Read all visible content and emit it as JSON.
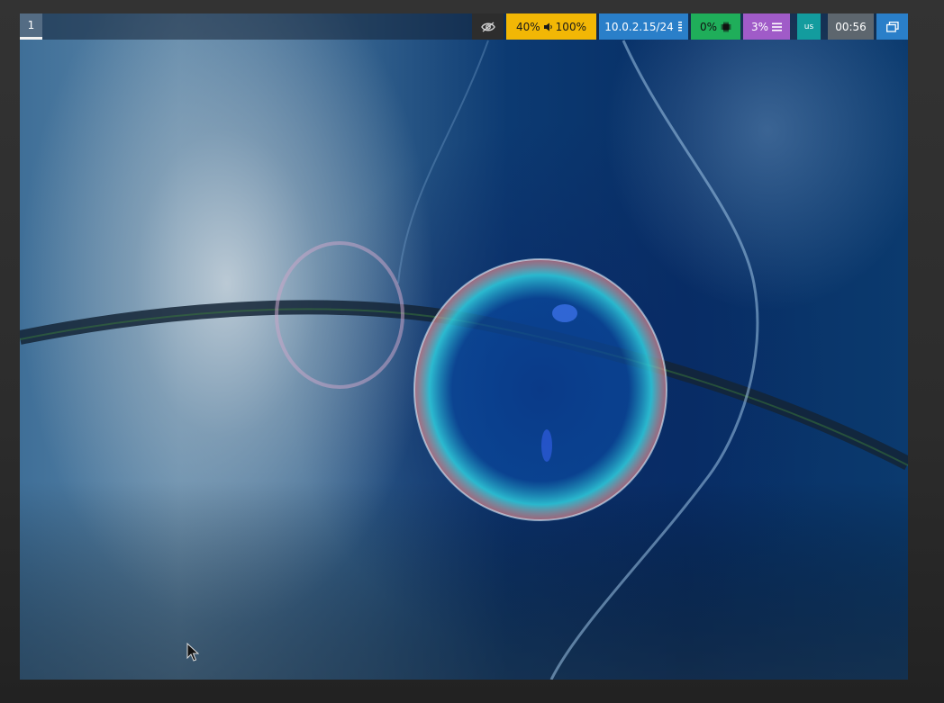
{
  "panel": {
    "workspace": "1",
    "audio": {
      "brightness": "40%",
      "volume": "100%"
    },
    "network": {
      "ip": "10.0.2.15/24"
    },
    "cpu": "0%",
    "memory": "3%",
    "keyboard_layout": "us",
    "clock": "00:56"
  },
  "icons": {
    "hidden": "eye-slash-icon",
    "speaker": "speaker-icon",
    "network": "ethernet-icon",
    "cpu": "chip-icon",
    "memory": "bars-icon",
    "windows": "window-stack-icon",
    "cursor": "mouse-pointer-icon"
  },
  "colors": {
    "audio_bg": "#f2b705",
    "network_bg": "#2a7fc9",
    "cpu_bg": "#1fae5a",
    "memory_bg": "#a05bc8",
    "layout_bg": "#139c9e",
    "clock_bg": "#5d666e"
  }
}
